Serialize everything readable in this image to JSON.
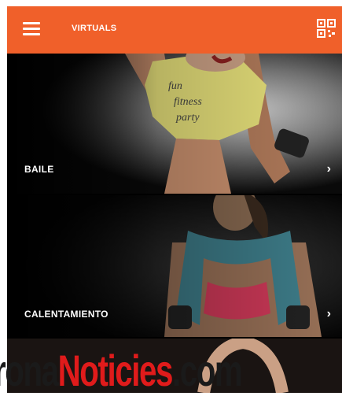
{
  "header": {
    "title": "VIRTUALS",
    "menu_icon": "hamburger-menu-icon",
    "qr_icon": "qr-code-icon",
    "color": "#f0602a"
  },
  "cards": [
    {
      "label": "BAILE",
      "icon": "chevron-right-icon"
    },
    {
      "label": "CALENTAMIENTO",
      "icon": "chevron-right-icon"
    }
  ],
  "watermark": {
    "prefix": "rona",
    "brand": "Noticies",
    "suffix": ".com"
  }
}
